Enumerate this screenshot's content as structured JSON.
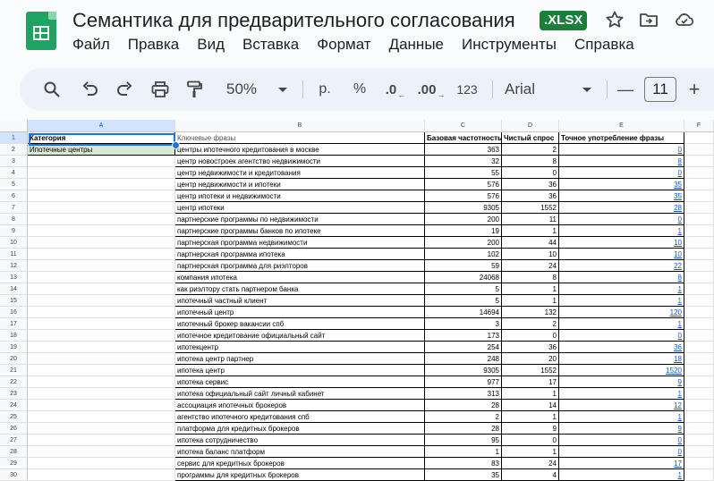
{
  "doc": {
    "title": "Семантика для предварительного согласования",
    "badge": ".XLSX"
  },
  "header_icons": [
    "star-icon",
    "move-to-folder-icon",
    "cloud-status-icon"
  ],
  "menu": [
    "Файл",
    "Правка",
    "Вид",
    "Вставка",
    "Формат",
    "Данные",
    "Инструменты",
    "Справка"
  ],
  "toolbar": {
    "zoom": "50%",
    "currency": "р.",
    "percent": "%",
    "dec_decrease": ".0",
    "dec_increase": ".00",
    "number_format": "123",
    "font": "Arial",
    "font_size": "11",
    "minus": "—",
    "plus": "+"
  },
  "columns": [
    "A",
    "B",
    "C",
    "D",
    "E",
    "F"
  ],
  "headers": {
    "a": "Категория",
    "b": "Ключевые фразы",
    "c": "Базовая частотность",
    "d": "Чистый спрос",
    "e": "Точное употребление фразы"
  },
  "a2": "Ипотечные центры",
  "rows": [
    {
      "n": "2",
      "b": "центры ипотечного кредитования в москве",
      "c": "363",
      "d": "2",
      "e": "0"
    },
    {
      "n": "3",
      "b": "центр новостроек агентство недвижимости",
      "c": "32",
      "d": "8",
      "e": "8"
    },
    {
      "n": "4",
      "b": "центр недвижимости и кредитования",
      "c": "55",
      "d": "0",
      "e": "0"
    },
    {
      "n": "5",
      "b": "центр недвижимости и ипотеки",
      "c": "576",
      "d": "36",
      "e": "35"
    },
    {
      "n": "6",
      "b": "центр ипотеки и недвижимости",
      "c": "576",
      "d": "36",
      "e": "35"
    },
    {
      "n": "7",
      "b": "центр ипотеки",
      "c": "9305",
      "d": "1552",
      "e": "28"
    },
    {
      "n": "8",
      "b": "партнерские программы по недвижимости",
      "c": "200",
      "d": "11",
      "e": "0"
    },
    {
      "n": "9",
      "b": "партнерские программы банков по ипотеке",
      "c": "19",
      "d": "1",
      "e": "1"
    },
    {
      "n": "10",
      "b": "партнерская программа недвижимости",
      "c": "200",
      "d": "44",
      "e": "10"
    },
    {
      "n": "11",
      "b": "партнерская программа ипотека",
      "c": "102",
      "d": "10",
      "e": "10"
    },
    {
      "n": "12",
      "b": "партнерская программа для риэлторов",
      "c": "59",
      "d": "24",
      "e": "22"
    },
    {
      "n": "13",
      "b": "компания ипотека",
      "c": "24068",
      "d": "8",
      "e": "8"
    },
    {
      "n": "14",
      "b": "как риэлтору стать партнером банка",
      "c": "5",
      "d": "1",
      "e": "1"
    },
    {
      "n": "15",
      "b": "ипотечный частный клиент",
      "c": "5",
      "d": "1",
      "e": "1"
    },
    {
      "n": "16",
      "b": "ипотечный центр",
      "c": "14694",
      "d": "132",
      "e": "120"
    },
    {
      "n": "17",
      "b": "ипотечный брокер вакансии спб",
      "c": "3",
      "d": "2",
      "e": "1"
    },
    {
      "n": "18",
      "b": "ипотечное кредитование официальный сайт",
      "c": "173",
      "d": "0",
      "e": "0"
    },
    {
      "n": "19",
      "b": "ипотекцентр",
      "c": "254",
      "d": "36",
      "e": "36"
    },
    {
      "n": "20",
      "b": "ипотека центр партнер",
      "c": "248",
      "d": "20",
      "e": "18"
    },
    {
      "n": "21",
      "b": "ипотека центр",
      "c": "9305",
      "d": "1552",
      "e": "1520"
    },
    {
      "n": "22",
      "b": "ипотека сервис",
      "c": "977",
      "d": "17",
      "e": "9"
    },
    {
      "n": "23",
      "b": "ипотека официальный сайт личный кабинет",
      "c": "313",
      "d": "1",
      "e": "1"
    },
    {
      "n": "24",
      "b": "ассоциация ипотечных брокеров",
      "c": "28",
      "d": "14",
      "e": "12"
    },
    {
      "n": "25",
      "b": "агентство ипотечного кредитования спб",
      "c": "2",
      "d": "1",
      "e": "1"
    },
    {
      "n": "26",
      "b": "платформа для кредитных брокеров",
      "c": "28",
      "d": "9",
      "e": "9"
    },
    {
      "n": "27",
      "b": "ипотека сотрудничество",
      "c": "95",
      "d": "0",
      "e": "0"
    },
    {
      "n": "28",
      "b": "ипотека баланс платформ",
      "c": "1",
      "d": "1",
      "e": "0"
    },
    {
      "n": "29",
      "b": "сервис для кредитных брокеров",
      "c": "83",
      "d": "24",
      "e": "17"
    },
    {
      "n": "30",
      "b": "программы для кредитных брокеров",
      "c": "35",
      "d": "4",
      "e": "1"
    }
  ]
}
